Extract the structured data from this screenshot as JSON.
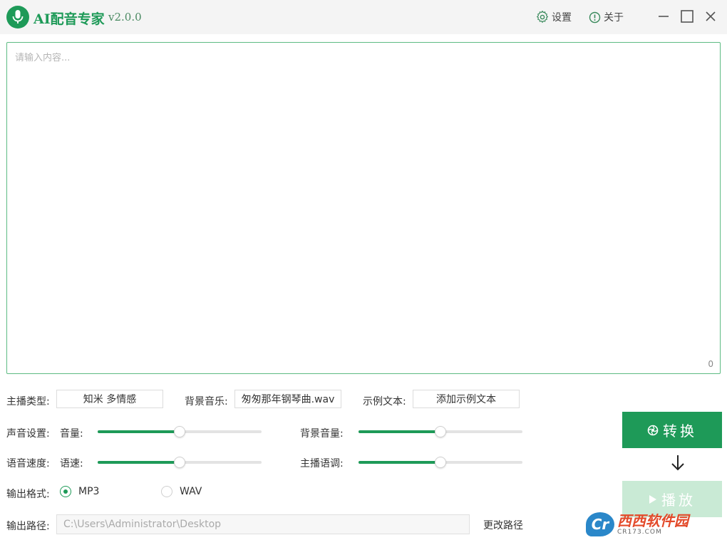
{
  "app": {
    "title": "AI配音专家",
    "version": "v2.0.0"
  },
  "titlebar": {
    "settings_label": "设置",
    "about_label": "关于"
  },
  "editor": {
    "placeholder": "请输入内容...",
    "value": "",
    "char_count": "0"
  },
  "controls": {
    "anchor_type_label": "主播类型:",
    "anchor_type_value": "知米 多情感",
    "bg_music_label": "背景音乐:",
    "bg_music_value": "匆匆那年钢琴曲.wav",
    "sample_text_label": "示例文本:",
    "sample_text_button": "添加示例文本",
    "sound_settings_label": "声音设置:",
    "volume_label": "音量:",
    "volume_level": 0.5,
    "bg_volume_label": "背景音量:",
    "bg_volume_level": 0.5,
    "speed_section_label": "语音速度:",
    "speed_label": "语速:",
    "speed_level": 0.5,
    "pitch_label": "主播语调:",
    "pitch_level": 0.5,
    "format_label": "输出格式:",
    "format_options": [
      "MP3",
      "WAV"
    ],
    "format_selected": "MP3",
    "path_label": "输出路径:",
    "path_value": "C:\\Users\\Administrator\\Desktop",
    "change_path_label": "更改路径"
  },
  "actions": {
    "convert_label": "转换",
    "play_label": "播放"
  },
  "watermark": {
    "main": "西西软件园",
    "sub": "CR173.COM"
  },
  "colors": {
    "accent": "#1e9a58",
    "accent_light": "#c9ead5"
  }
}
